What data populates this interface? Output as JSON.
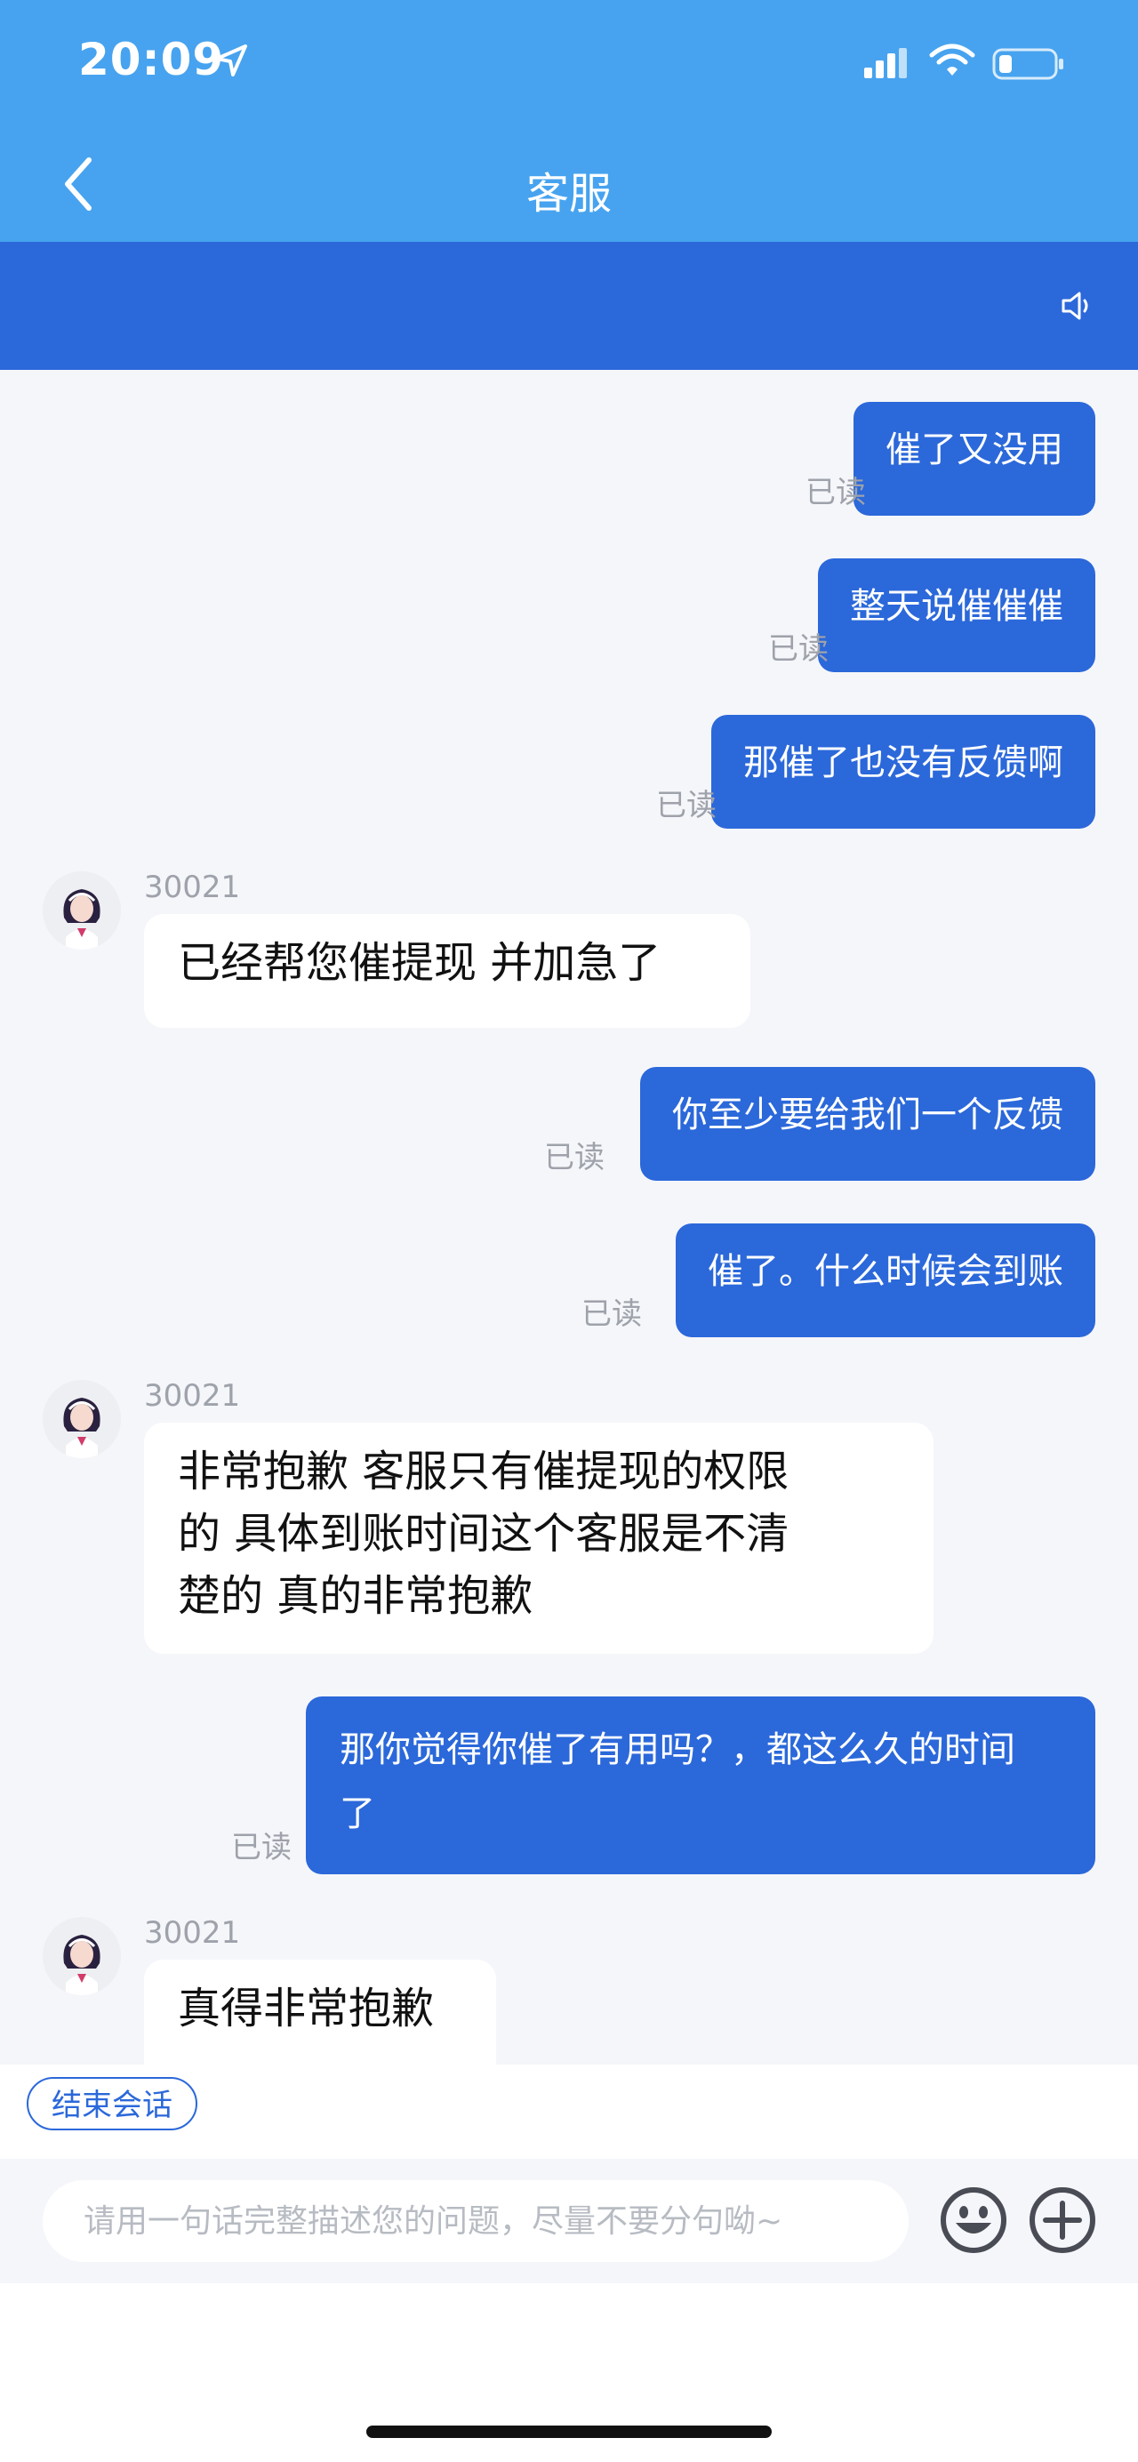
{
  "status_bar": {
    "time": "20:09",
    "icons": [
      "location-arrow-icon",
      "cellular-signal-icon",
      "wifi-icon",
      "battery-icon"
    ]
  },
  "header": {
    "title": "客服",
    "back_icon": "chevron-left-icon"
  },
  "banner": {
    "icon": "speaker-icon"
  },
  "messages": [
    {
      "direction": "out",
      "text": "催了又没用",
      "status": "已读"
    },
    {
      "direction": "out",
      "text": "整天说催催催",
      "status": "已读"
    },
    {
      "direction": "out",
      "text": "那催了也没有反馈啊",
      "status": "已读"
    },
    {
      "direction": "in",
      "sender": "30021",
      "lines": [
        "已经帮您催提现 并加急了"
      ]
    },
    {
      "direction": "out",
      "text": "你至少要给我们一个反馈",
      "status": "已读"
    },
    {
      "direction": "out",
      "text": "催了。什么时候会到账",
      "status": "已读"
    },
    {
      "direction": "in",
      "sender": "30021",
      "lines": [
        "非常抱歉 客服只有催提现的权限",
        "的 具体到账时间这个客服是不清",
        "楚的 真的非常抱歉"
      ]
    },
    {
      "direction": "out",
      "lines": [
        "那你觉得你催了有用吗？，都这么久的时间",
        "了"
      ],
      "status": "已读"
    },
    {
      "direction": "in",
      "sender": "30021",
      "lines": [
        "真得非常抱歉"
      ]
    }
  ],
  "footer": {
    "end_session_label": "结束会话",
    "input_placeholder": "请用一句话完整描述您的问题，尽量不要分句呦~",
    "emoji_icon": "emoji-smile-icon",
    "plus_icon": "plus-circle-icon"
  },
  "colors": {
    "header_bg": "#47a3ef",
    "banner_bg": "#2b68da",
    "outgoing_bubble": "#2b68da",
    "chat_bg": "#f5f6fa"
  }
}
